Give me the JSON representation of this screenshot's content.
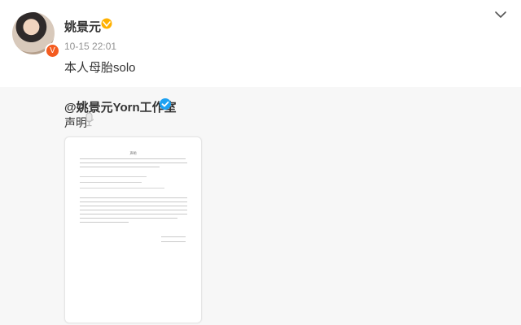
{
  "post": {
    "author": "姚景元",
    "time": "10-15 22:01",
    "text": "本人母胎solo"
  },
  "repost": {
    "author": "@姚景元Yorn工作室",
    "text": "声明"
  },
  "document": {
    "title": "声明"
  },
  "icons": {
    "vip": "vip-badge-icon",
    "verified": "verified-icon",
    "menu": "chevron-down-icon",
    "mic": "microphone-icon"
  },
  "colors": {
    "brand_orange": "#f45b1f",
    "verified_blue": "#1da1f2",
    "text_main": "#333333",
    "text_muted": "#939393",
    "repost_bg": "#f7f7f7"
  }
}
